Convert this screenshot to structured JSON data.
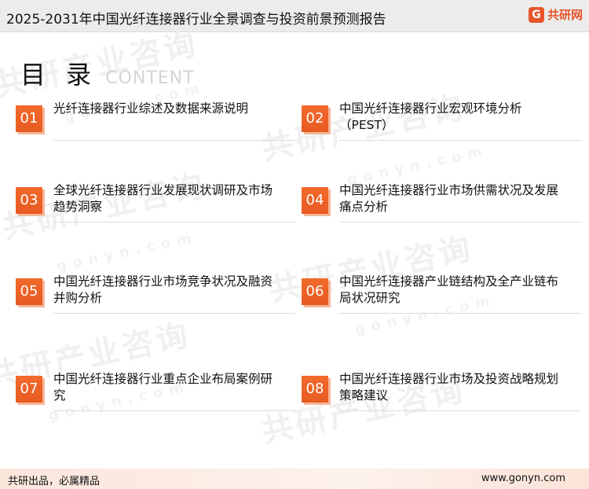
{
  "header": {
    "title": "2025-2031年中国光纤连接器行业全景调查与投资前景预测报告",
    "logo_mark": "G",
    "logo_text": "共研网"
  },
  "toc": {
    "heading": "目 录",
    "heading_en": "CONTENT",
    "items": [
      {
        "num": "01",
        "label": "光纤连接器行业综述及数据来源说明"
      },
      {
        "num": "02",
        "label": "中国光纤连接器行业宏观环境分析（PEST）"
      },
      {
        "num": "03",
        "label": "全球光纤连接器行业发展现状调研及市场趋势洞察"
      },
      {
        "num": "04",
        "label": "中国光纤连接器行业市场供需状况及发展痛点分析"
      },
      {
        "num": "05",
        "label": "中国光纤连接器行业市场竞争状况及融资并购分析"
      },
      {
        "num": "06",
        "label": "中国光纤连接器产业链结构及全产业链布局状况研究"
      },
      {
        "num": "07",
        "label": "中国光纤连接器行业重点企业布局案例研究"
      },
      {
        "num": "08",
        "label": "中国光纤连接器行业市场及投资战略规划策略建议"
      }
    ]
  },
  "watermark": {
    "text": "共研产业咨询",
    "sub": "gonyn.com"
  },
  "footer": {
    "slogan": "共研出品，必属精品",
    "url": "www.gonyn.com"
  },
  "colors": {
    "accent": "#e8552b",
    "header_bg": "#ececec",
    "footer_bg": "#fbe6dc"
  }
}
